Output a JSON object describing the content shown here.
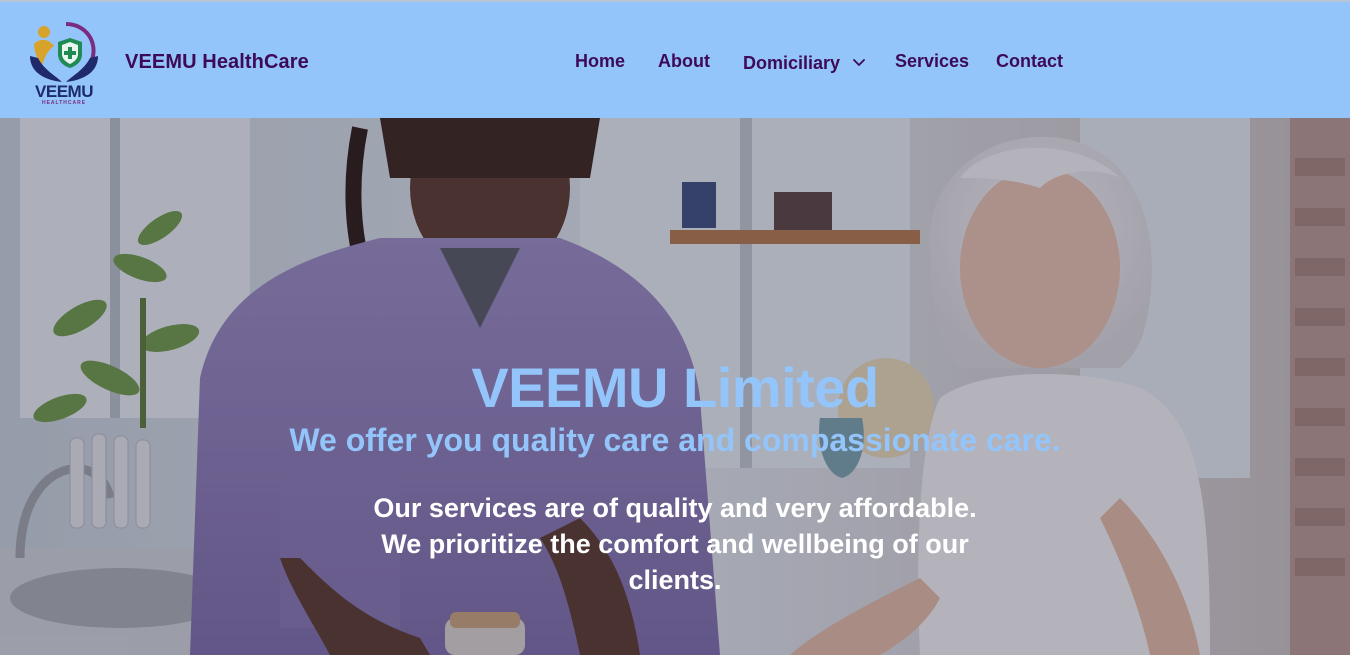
{
  "header": {
    "brand_name": "VEEMU HealthCare",
    "logo": {
      "text": "VEEMU",
      "subtext": "HEALTHCARE",
      "icon": "care-hands-shield-icon"
    },
    "nav": {
      "home": "Home",
      "about": "About",
      "domiciliary": "Domiciliary",
      "services": "Services",
      "contact": "Contact"
    },
    "dropdown_icon": "chevron-down-icon"
  },
  "hero": {
    "title": "VEEMU Limited",
    "tagline": "We offer you quality care and compassionate care.",
    "description": "Our services are of quality and very affordable. We prioritize the comfort and wellbeing of our clients."
  },
  "colors": {
    "header_bg": "#93c5fb",
    "nav_text": "#3d0a57",
    "hero_accent": "#93c5fb",
    "hero_text": "#ffffff"
  }
}
